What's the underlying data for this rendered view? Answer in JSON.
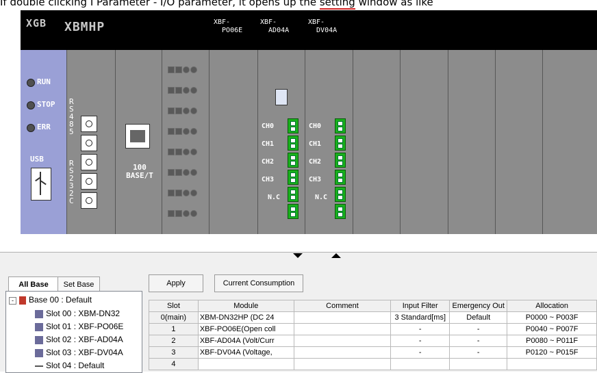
{
  "caption": {
    "before": "If double clicking I Parameter - I/O parameter, it opens up the ",
    "underlined": "setting",
    "after": " window as like"
  },
  "rack": {
    "logo1": "XGB",
    "logo2": "XBMHP",
    "modules": [
      {
        "label": "XBF-\n  PO06E"
      },
      {
        "label": "XBF-\n  AD04A"
      },
      {
        "label": "XBF-\n  DV04A"
      }
    ],
    "leds": [
      "RUN",
      "STOP",
      "ERR"
    ],
    "usb": "USB",
    "rs485": "RS485",
    "rs232c": "RS232C",
    "ethernet": "100\nBASE/T",
    "channels": [
      "CH0",
      "CH1",
      "CH2",
      "CH3",
      "N.C"
    ],
    "colors": {
      "cpu": "#9aa0d6",
      "body": "#8c8c8c",
      "terminal": "#19b01c"
    }
  },
  "divider": {
    "collapse_icon": "triangle-down-icon",
    "expand_icon": "triangle-up-icon"
  },
  "tabs": [
    "All Base",
    "Set Base"
  ],
  "tree": {
    "base": "Base 00 : Default",
    "slots": [
      "Slot 00 : XBM-DN32",
      "Slot 01 : XBF-PO06E",
      "Slot 02 : XBF-AD04A",
      "Slot 03 : XBF-DV04A",
      "Slot 04 : Default"
    ]
  },
  "buttons": {
    "apply": "Apply",
    "consumption": "Current Consumption"
  },
  "table": {
    "headers": [
      "Slot",
      "Module",
      "Comment",
      "Input Filter",
      "Emergency Out",
      "Allocation"
    ],
    "rows": [
      [
        "0(main)",
        "XBM-DN32HP (DC 24",
        "",
        "3 Standard[ms]",
        "Default",
        "P0000 ~ P003F"
      ],
      [
        "1",
        "XBF-PO06E(Open coll",
        "",
        "-",
        "-",
        "P0040 ~ P007F"
      ],
      [
        "2",
        "XBF-AD04A (Volt/Curr",
        "",
        "-",
        "-",
        "P0080 ~ P011F"
      ],
      [
        "3",
        "XBF-DV04A (Voltage,",
        "",
        "-",
        "-",
        "P0120 ~ P015F"
      ],
      [
        "4",
        "",
        "",
        "",
        "",
        ""
      ]
    ]
  }
}
